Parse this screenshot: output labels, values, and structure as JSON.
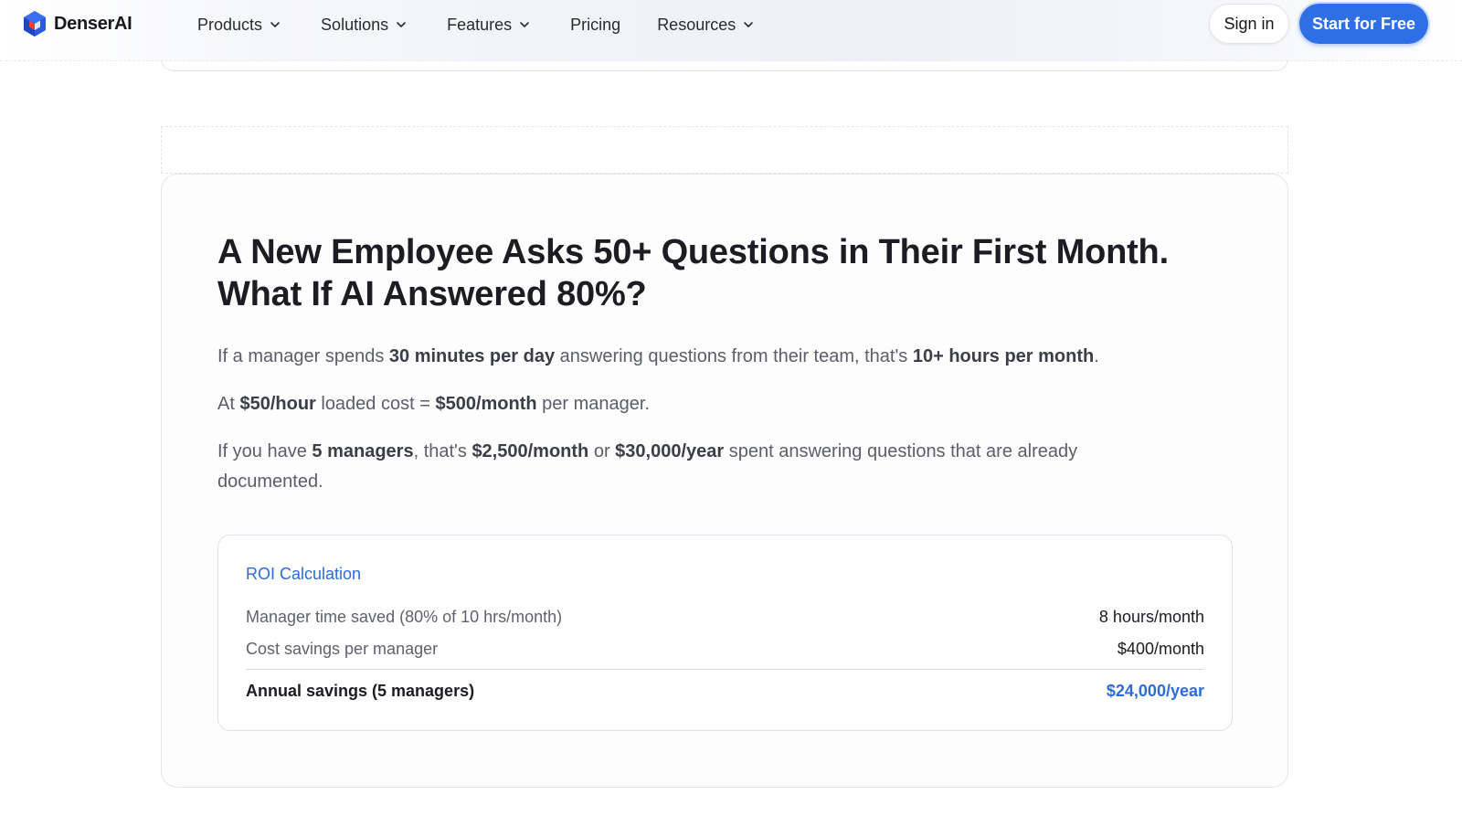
{
  "header": {
    "brand": "DenserAI",
    "nav": [
      {
        "label": "Products",
        "has_dropdown": true
      },
      {
        "label": "Solutions",
        "has_dropdown": true
      },
      {
        "label": "Features",
        "has_dropdown": true
      },
      {
        "label": "Pricing",
        "has_dropdown": false
      },
      {
        "label": "Resources",
        "has_dropdown": true
      }
    ],
    "sign_in": "Sign in",
    "cta": "Start for Free"
  },
  "section": {
    "title_line1": "A New Employee Asks 50+ Questions in Their First Month.",
    "title_line2": "What If AI Answered 80%?",
    "p1": {
      "t1": "If a manager spends ",
      "b1": "30 minutes per day",
      "t2": " answering questions from their team, that's ",
      "b2": "10+ hours per month",
      "t3": "."
    },
    "p2": {
      "t1": "At ",
      "b1": "$50/hour",
      "t2": " loaded cost = ",
      "b2": "$500/month",
      "t3": " per manager."
    },
    "p3": {
      "t1": "If you have ",
      "b1": "5 managers",
      "t2": ", that's ",
      "b2": "$2,500/month",
      "t3": " or ",
      "b3": "$30,000/year",
      "t4": " spent answering questions that are already documented."
    }
  },
  "roi": {
    "title": "ROI Calculation",
    "rows": [
      {
        "label": "Manager time saved (80% of 10 hrs/month)",
        "value": "8 hours/month"
      },
      {
        "label": "Cost savings per manager",
        "value": "$400/month"
      }
    ],
    "total": {
      "label": "Annual savings (5 managers)",
      "value": "$24,000/year"
    }
  },
  "colors": {
    "accent": "#2f6fe6",
    "roi_accent": "#2e6bd6",
    "logo_blue": "#2b59e0",
    "logo_red": "#e5443b"
  },
  "icons": {
    "logo": "denserai-hexagon-logo-icon",
    "dropdown": "chevron-down-icon"
  }
}
